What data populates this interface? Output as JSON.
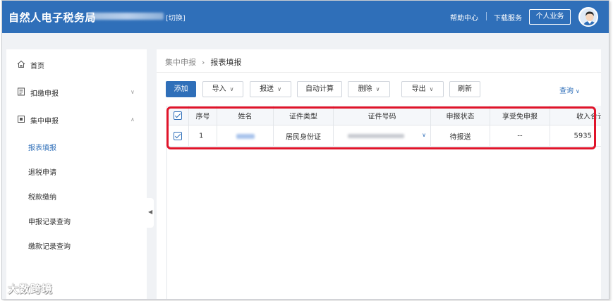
{
  "header": {
    "brand": "自然人电子税务局",
    "switch_label": "[切换]",
    "help_label": "帮助中心",
    "download_label": "下载服务",
    "personal_button": "个人业务"
  },
  "sidebar": {
    "home": "首页",
    "withholding": "扣缴申报",
    "centralized": "集中申报",
    "sub_items": [
      "报表填报",
      "退税申请",
      "税款缴纳",
      "申报记录查询",
      "缴款记录查询"
    ]
  },
  "breadcrumb": {
    "parent": "集中申报",
    "separator": "›",
    "current": "报表填报"
  },
  "toolbar": {
    "add": "添加",
    "import": "导入",
    "submit": "报送",
    "auto_calc": "自动计算",
    "delete": "删除",
    "export": "导出",
    "refresh": "刷新",
    "query": "查询"
  },
  "table": {
    "columns": [
      "序号",
      "姓名",
      "证件类型",
      "证件号码",
      "申报状态",
      "享受免申报",
      "收入合计"
    ],
    "rows": [
      {
        "index": "1",
        "id_type": "居民身份证",
        "status": "待报送",
        "exempt": "--",
        "income": "5935"
      }
    ]
  },
  "colors": {
    "header_blue": "#2f6fb9",
    "highlight_red": "#e0142a",
    "active_link": "#2f6fb9"
  },
  "watermark": "大数跨境"
}
